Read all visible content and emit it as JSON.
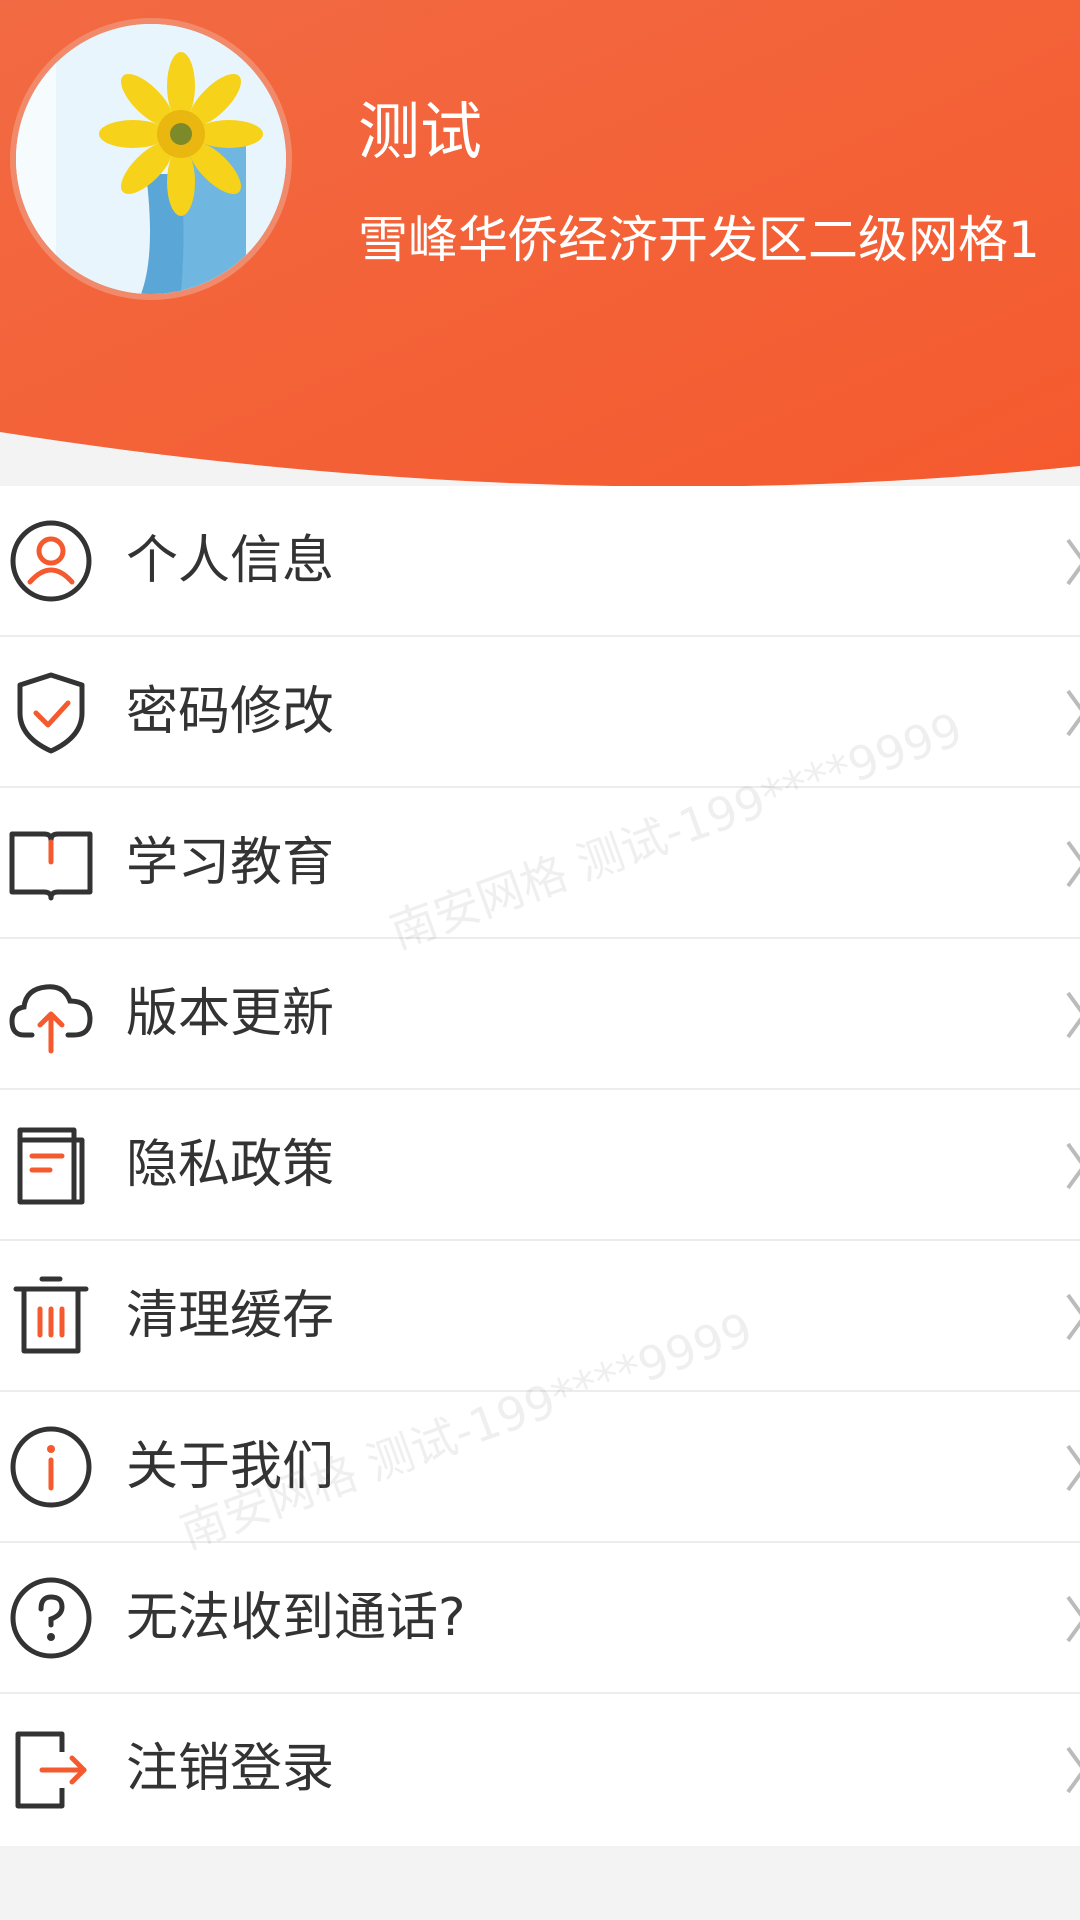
{
  "profile": {
    "name": "测试",
    "organization": "雪峰华侨经济开发区二级网格1"
  },
  "menu": [
    {
      "label": "个人信息",
      "icon": "user-icon"
    },
    {
      "label": "密码修改",
      "icon": "shield-check-icon"
    },
    {
      "label": "学习教育",
      "icon": "book-icon"
    },
    {
      "label": "版本更新",
      "icon": "cloud-upload-icon"
    },
    {
      "label": "隐私政策",
      "icon": "document-icon"
    },
    {
      "label": "清理缓存",
      "icon": "trash-icon"
    },
    {
      "label": "关于我们",
      "icon": "info-icon"
    },
    {
      "label": "无法收到通话?",
      "icon": "help-icon"
    },
    {
      "label": "注销登录",
      "icon": "logout-icon"
    }
  ],
  "watermark": "南安网格 测试-199****9999",
  "colors": {
    "accent": "#f55a2e",
    "header_gradient_start": "#f26a43",
    "header_gradient_end": "#f55a2e",
    "icon_outline": "#333333"
  }
}
